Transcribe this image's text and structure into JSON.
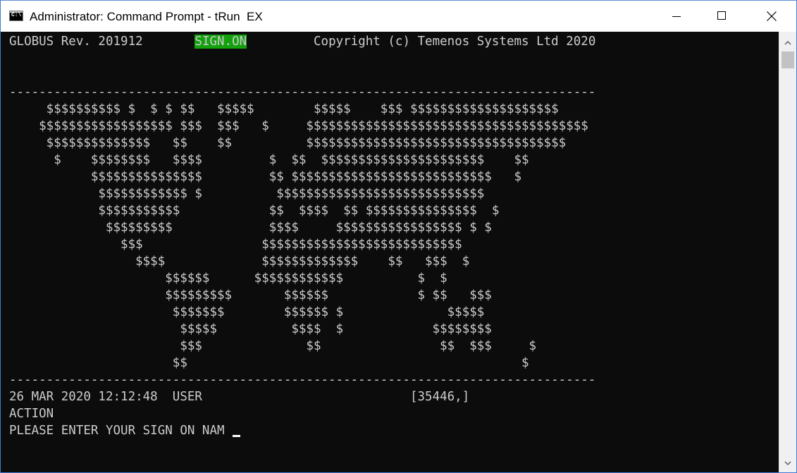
{
  "window": {
    "title": "Administrator: Command Prompt - tRun  EX",
    "icon": "cmd-icon",
    "icon_glyph": "C:\\"
  },
  "console": {
    "header": {
      "product": "GLOBUS Rev. 201912",
      "screen_name": "SIGN.ON",
      "copyright": "Copyright (c) Temenos Systems Ltd 2020",
      "highlight_color": "#13a10e"
    },
    "separator": "-------------------------------------------------------------------------------",
    "banner_art": [
      "     $$$$$$$$$$ $  $ $ $$   $$$$$        $$$$$    $$$ $$$$$$$$$$$$$$$$$$$$",
      "    $$$$$$$$$$$$$$$$$$ $$$  $$$   $     $$$$$$$$$$$$$$$$$$$$$$$$$$$$$$$$$$$$$$",
      "     $$$$$$$$$$$$$$   $$    $$          $$$$$$$$$$$$$$$$$$$$$$$$$$$$$$$$$$$",
      "      $    $$$$$$$$   $$$$         $  $$  $$$$$$$$$$$$$$$$$$$$$$    $$",
      "           $$$$$$$$$$$$$$$         $$ $$$$$$$$$$$$$$$$$$$$$$$$$$$   $",
      "            $$$$$$$$$$$$ $          $$$$$$$$$$$$$$$$$$$$$$$$$$$$",
      "            $$$$$$$$$$$            $$  $$$$  $$ $$$$$$$$$$$$$$$  $",
      "             $$$$$$$$$             $$$$     $$$$$$$$$$$$$$$$$ $ $",
      "               $$$                $$$$$$$$$$$$$$$$$$$$$$$$$$$",
      "                 $$$$             $$$$$$$$$$$$$    $$   $$$  $",
      "                     $$$$$$      $$$$$$$$$$$$          $  $",
      "                     $$$$$$$$$       $$$$$$            $ $$   $$$",
      "                      $$$$$$$        $$$$$$ $              $$$$$",
      "                       $$$$$          $$$$  $            $$$$$$$$",
      "                       $$$              $$                $$  $$$     $",
      "                      $$                                             $"
    ],
    "status": {
      "datetime": "26 MAR 2020 12:12:48",
      "user_label": "USER",
      "session_id": "[35446,]"
    },
    "action_label": "ACTION",
    "prompt": "PLEASE ENTER YOUR SIGN ON NAM "
  },
  "scrollbar": {
    "up_icon": "scroll-up-arrow-icon",
    "down_icon": "scroll-down-arrow-icon"
  }
}
